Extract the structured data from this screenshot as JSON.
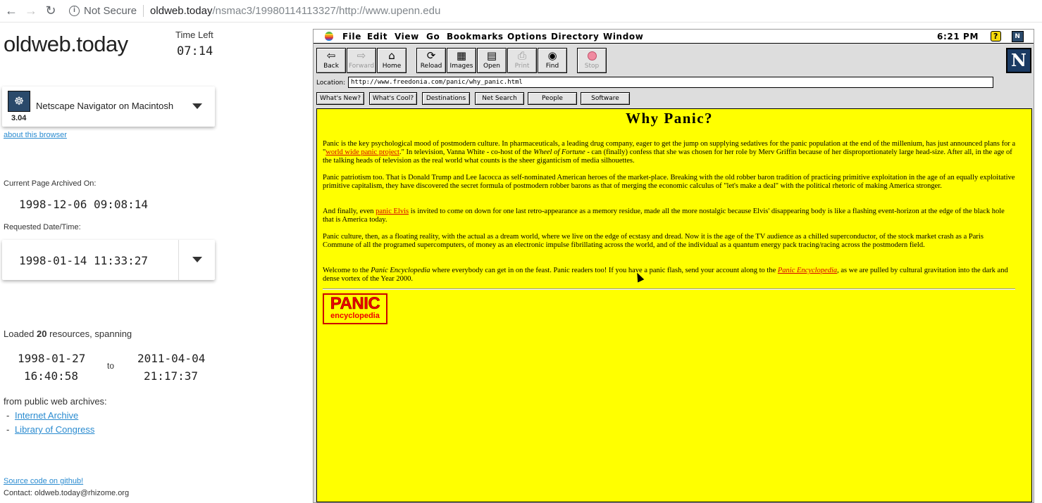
{
  "chrome": {
    "not_secure": "Not Secure",
    "url_host": "oldweb.today",
    "url_path": "/nsmac3/19980114113327/http://www.upenn.edu"
  },
  "left": {
    "brand": "oldweb.today",
    "time_left_label": "Time Left",
    "time_left": "07:14",
    "browser_name": "Netscape Navigator on Macintosh",
    "browser_version": "3.04",
    "about_link": "about this browser",
    "archived_label": "Current Page Archived On:",
    "archived_date": "1998-12-06 09:08:14",
    "requested_label": "Requested Date/Time:",
    "requested_date": "1998-01-14 11:33:27",
    "loaded_prefix": "Loaded ",
    "loaded_count": "20",
    "loaded_suffix": " resources, spanning",
    "range_start_date": "1998-01-27",
    "range_start_time": "16:40:58",
    "range_to": "to",
    "range_end_date": "2011-04-04",
    "range_end_time": "21:17:37",
    "archives_label": "from public web archives:",
    "archives": [
      "Internet Archive",
      "Library of Congress"
    ],
    "source_link": "Source code on github!",
    "contact": "Contact: oldweb.today@rhizome.org"
  },
  "mac": {
    "menu": [
      "File",
      "Edit",
      "View",
      "Go",
      "Bookmarks",
      "Options",
      "Directory",
      "Window"
    ],
    "clock": "6:21 PM",
    "toolbar": [
      "Back",
      "Forward",
      "Home",
      "Reload",
      "Images",
      "Open",
      "Print",
      "Find",
      "Stop"
    ],
    "location_label": "Location:",
    "location_url": "http://www.freedonia.com/panic/why_panic.html",
    "directory_buttons": [
      "What's New?",
      "What's Cool?",
      "Destinations",
      "Net Search",
      "People",
      "Software"
    ]
  },
  "page": {
    "title": "Why Panic?",
    "p1_a": "Panic is the key psychological mood of postmodern culture. In pharmaceuticals, a leading drug company, eager to get the jump on supplying sedatives for the panic population at the end of the millenium, has just announced plans for a \"",
    "p1_link": "world wide panic project",
    "p1_b": ".\" In television, Vanna White - co-host of the ",
    "p1_em": "Wheel of Fortune",
    "p1_c": " - can (finally) confess that she was chosen for her role by Merv Griffin because of her disproportionately large head-size. After all, in the age of the talking heads of television as the real world what counts is the sheer giganticism of media silhouettes.",
    "p2": "Panic patriotism too. That is Donald Trump and Lee Iacocca as self-nominated American heroes of the market-place. Breaking with the old robber baron tradition of practicing primitive exploitation in the age of an equally exploitative primitive capitalism, they have discovered the secret formula of postmodern robber barons as that of merging the economic calculus of \"let's make a deal\" with the political rhetoric of making America stronger.",
    "p3_a": "And finally, even ",
    "p3_link": "panic Elvis",
    "p3_b": " is invited to come on down for one last retro-appearance as a memory residue, made all the more nostalgic because Elvis' disappearing body is like a flashing event-horizon at the edge of the black hole that is America today.",
    "p4": "Panic culture, then, as a floating reality, with the actual as a dream world, where we live on the edge of ecstasy and dread. Now it is the age of the TV audience as a chilled superconductor, of the stock market crash as a Paris Commune of all the programed supercomputers, of money as an electronic impulse fibrillating across the world, and of the individual as a quantum energy pack tracing/racing across the postmodern field.",
    "p5_a": "Welcome to the ",
    "p5_em": "Panic Encyclopedia",
    "p5_b": " where everybody can get in on the feast. Panic readers too! If you have a panic flash, send your account along to the ",
    "p5_link": "Panic Encyclopedia",
    "p5_c": ", as we are pulled by cultural gravitation into the dark and dense vortex of the Year 2000.",
    "logo_big": "PANIC",
    "logo_small": "encyclopedia"
  },
  "colors": {
    "page_bg": "#ffff00",
    "link": "#d40000",
    "left_link": "#2a8bd0"
  }
}
